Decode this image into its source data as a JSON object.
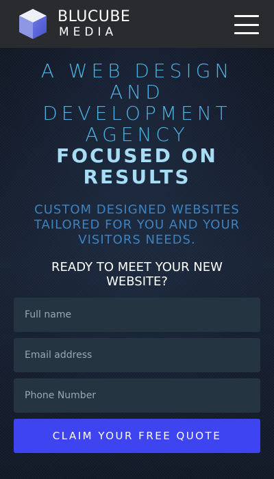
{
  "header": {
    "logo_line1": "BLUCUBE",
    "logo_line2": "MEDIA",
    "menu_icon": "hamburger-menu-icon"
  },
  "hero": {
    "headline_light_1": "A WEB DESIGN",
    "headline_light_2": "AND",
    "headline_light_3": "DEVELOPMENT",
    "headline_light_4": "AGENCY",
    "headline_bold_1": "FOCUSED ON",
    "headline_bold_2": "RESULTS",
    "subhead": "CUSTOM DESIGNED WEBSITES TAILORED FOR YOU AND YOUR VISITORS NEEDS."
  },
  "form": {
    "title": "READY TO MEET YOUR NEW WEBSITE?",
    "name_placeholder": "Full name",
    "email_placeholder": "Email address",
    "phone_placeholder": "Phone Number",
    "submit_label": "CLAIM YOUR FREE QUOTE"
  },
  "colors": {
    "header_bg": "#2a2b2f",
    "headline_light": "#4fb2e4",
    "headline_bold": "#a7dcf5",
    "subhead": "#3d82c0",
    "field_bg": "#253441",
    "button_bg": "#3e45f0"
  }
}
